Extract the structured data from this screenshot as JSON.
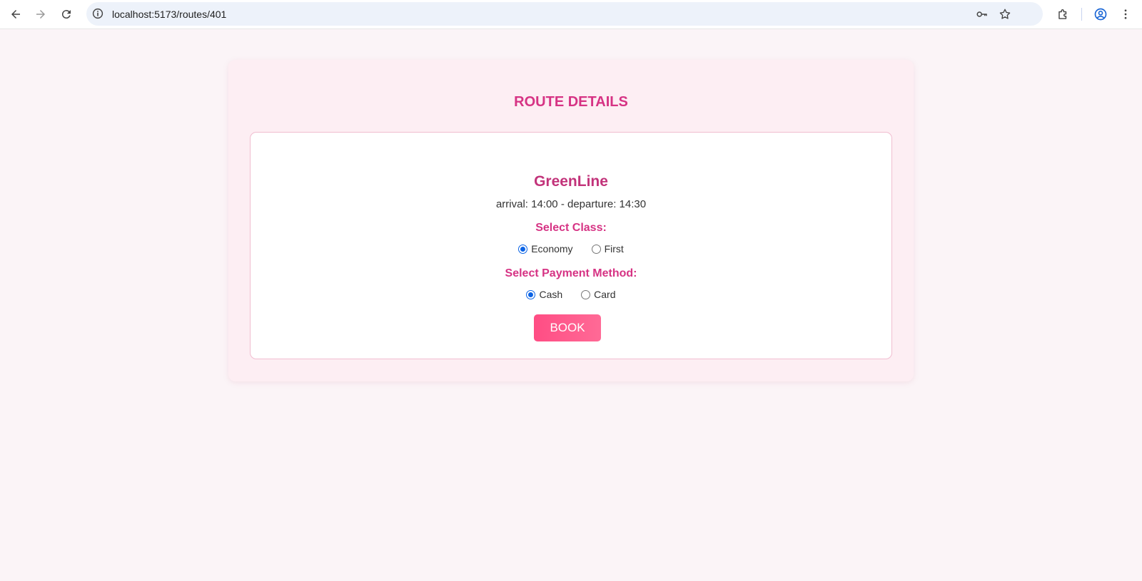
{
  "browser": {
    "url": "localhost:5173/routes/401",
    "icons": {
      "back": "back-arrow-icon",
      "forward": "forward-arrow-icon",
      "reload": "reload-icon",
      "site_info": "site-info-icon",
      "password": "key-icon",
      "bookmark": "star-icon",
      "extensions": "puzzle-icon",
      "profile": "profile-icon",
      "menu": "kebab-menu-icon"
    }
  },
  "page": {
    "title": "ROUTE DETAILS",
    "route": {
      "name": "GreenLine",
      "times": "arrival: 14:00 - departure: 14:30"
    },
    "class_section": {
      "label": "Select Class:",
      "options": [
        {
          "label": "Economy",
          "checked": true
        },
        {
          "label": "First",
          "checked": false
        }
      ]
    },
    "payment_section": {
      "label": "Select Payment Method:",
      "options": [
        {
          "label": "Cash",
          "checked": true
        },
        {
          "label": "Card",
          "checked": false
        }
      ]
    },
    "book_label": "BOOK"
  },
  "colors": {
    "accent": "#d63384",
    "button": "#ff5a8c",
    "radio_checked": "#0b63e5",
    "page_bg": "#fbf4f7",
    "card_bg": "#fdeef3"
  }
}
